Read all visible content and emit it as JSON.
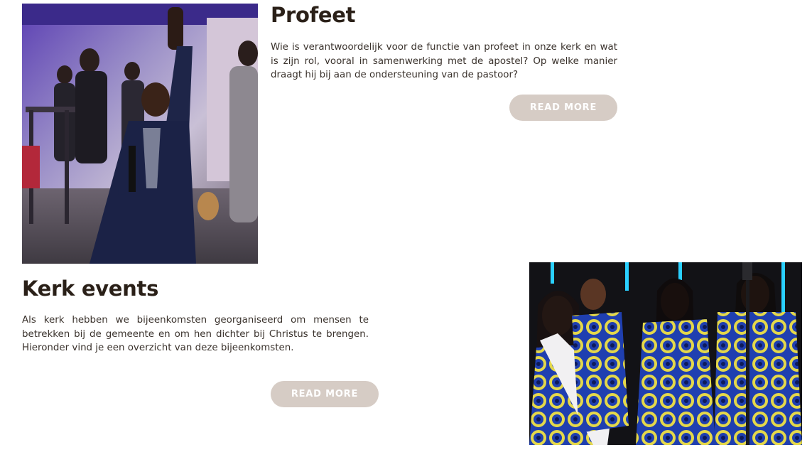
{
  "sections": [
    {
      "id": "profeet",
      "title": "Profeet",
      "text": "Wie is verantwoordelijk voor de functie van profeet in onze kerk en wat is zijn rol, vooral in samenwerking met de apostel? Op welke manier draagt hij bij aan de ondersteuning van de pastoor?",
      "button_label": "READ MORE",
      "image": "photo-man-praying-with-microphone"
    },
    {
      "id": "kerk-events",
      "title": "Kerk events",
      "text": "Als kerk hebben we bijeenkomsten georganiseerd om mensen te betrekken bij de gemeente en om hen dichter bij Christus te brengen. Hieronder vind je een overzicht van deze bijeenkomsten.",
      "button_label": "READ MORE",
      "image": "photo-choir-singers-blue-dresses"
    }
  ],
  "colors": {
    "heading": "#2a2018",
    "body_text": "#3a322c",
    "button_bg": "#d6ccc5",
    "button_text": "#ffffff"
  }
}
